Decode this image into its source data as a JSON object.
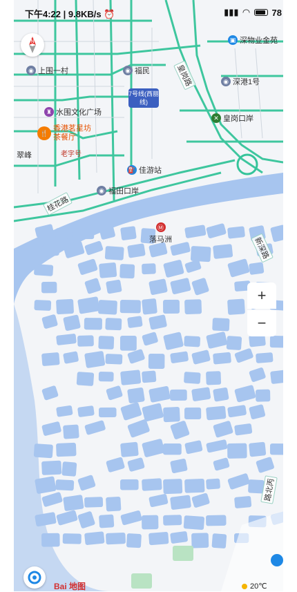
{
  "status_bar": {
    "time": "下午4:22",
    "speed": "9.8KB/s",
    "battery": "78"
  },
  "map": {
    "pois": {
      "shangwei": "上围一村",
      "fumin": "福民",
      "shenwu": "深物业金苑",
      "shengang": "深港1号",
      "huanggang_port": "皇岗口岸",
      "water_plaza": "水围文化广场",
      "hk_restaurant": "香港茗星坊\n茶餐厅",
      "old_brand": "老字号",
      "cuifeng": "翠峰",
      "jiayou": "佳游站",
      "futian_port": "福田口岸",
      "luomazhou": "落马洲"
    },
    "road_labels": {
      "huanggang_road": "皇岗路",
      "guihua_road": "桂花路",
      "xinshen_road": "新深路",
      "hkroad": "路北丙"
    },
    "metro_line": "7号线(西丽线)"
  },
  "controls": {
    "zoom_in": "+",
    "zoom_out": "−"
  },
  "footer": {
    "logo": "Bai 地图",
    "weather": "20℃"
  }
}
